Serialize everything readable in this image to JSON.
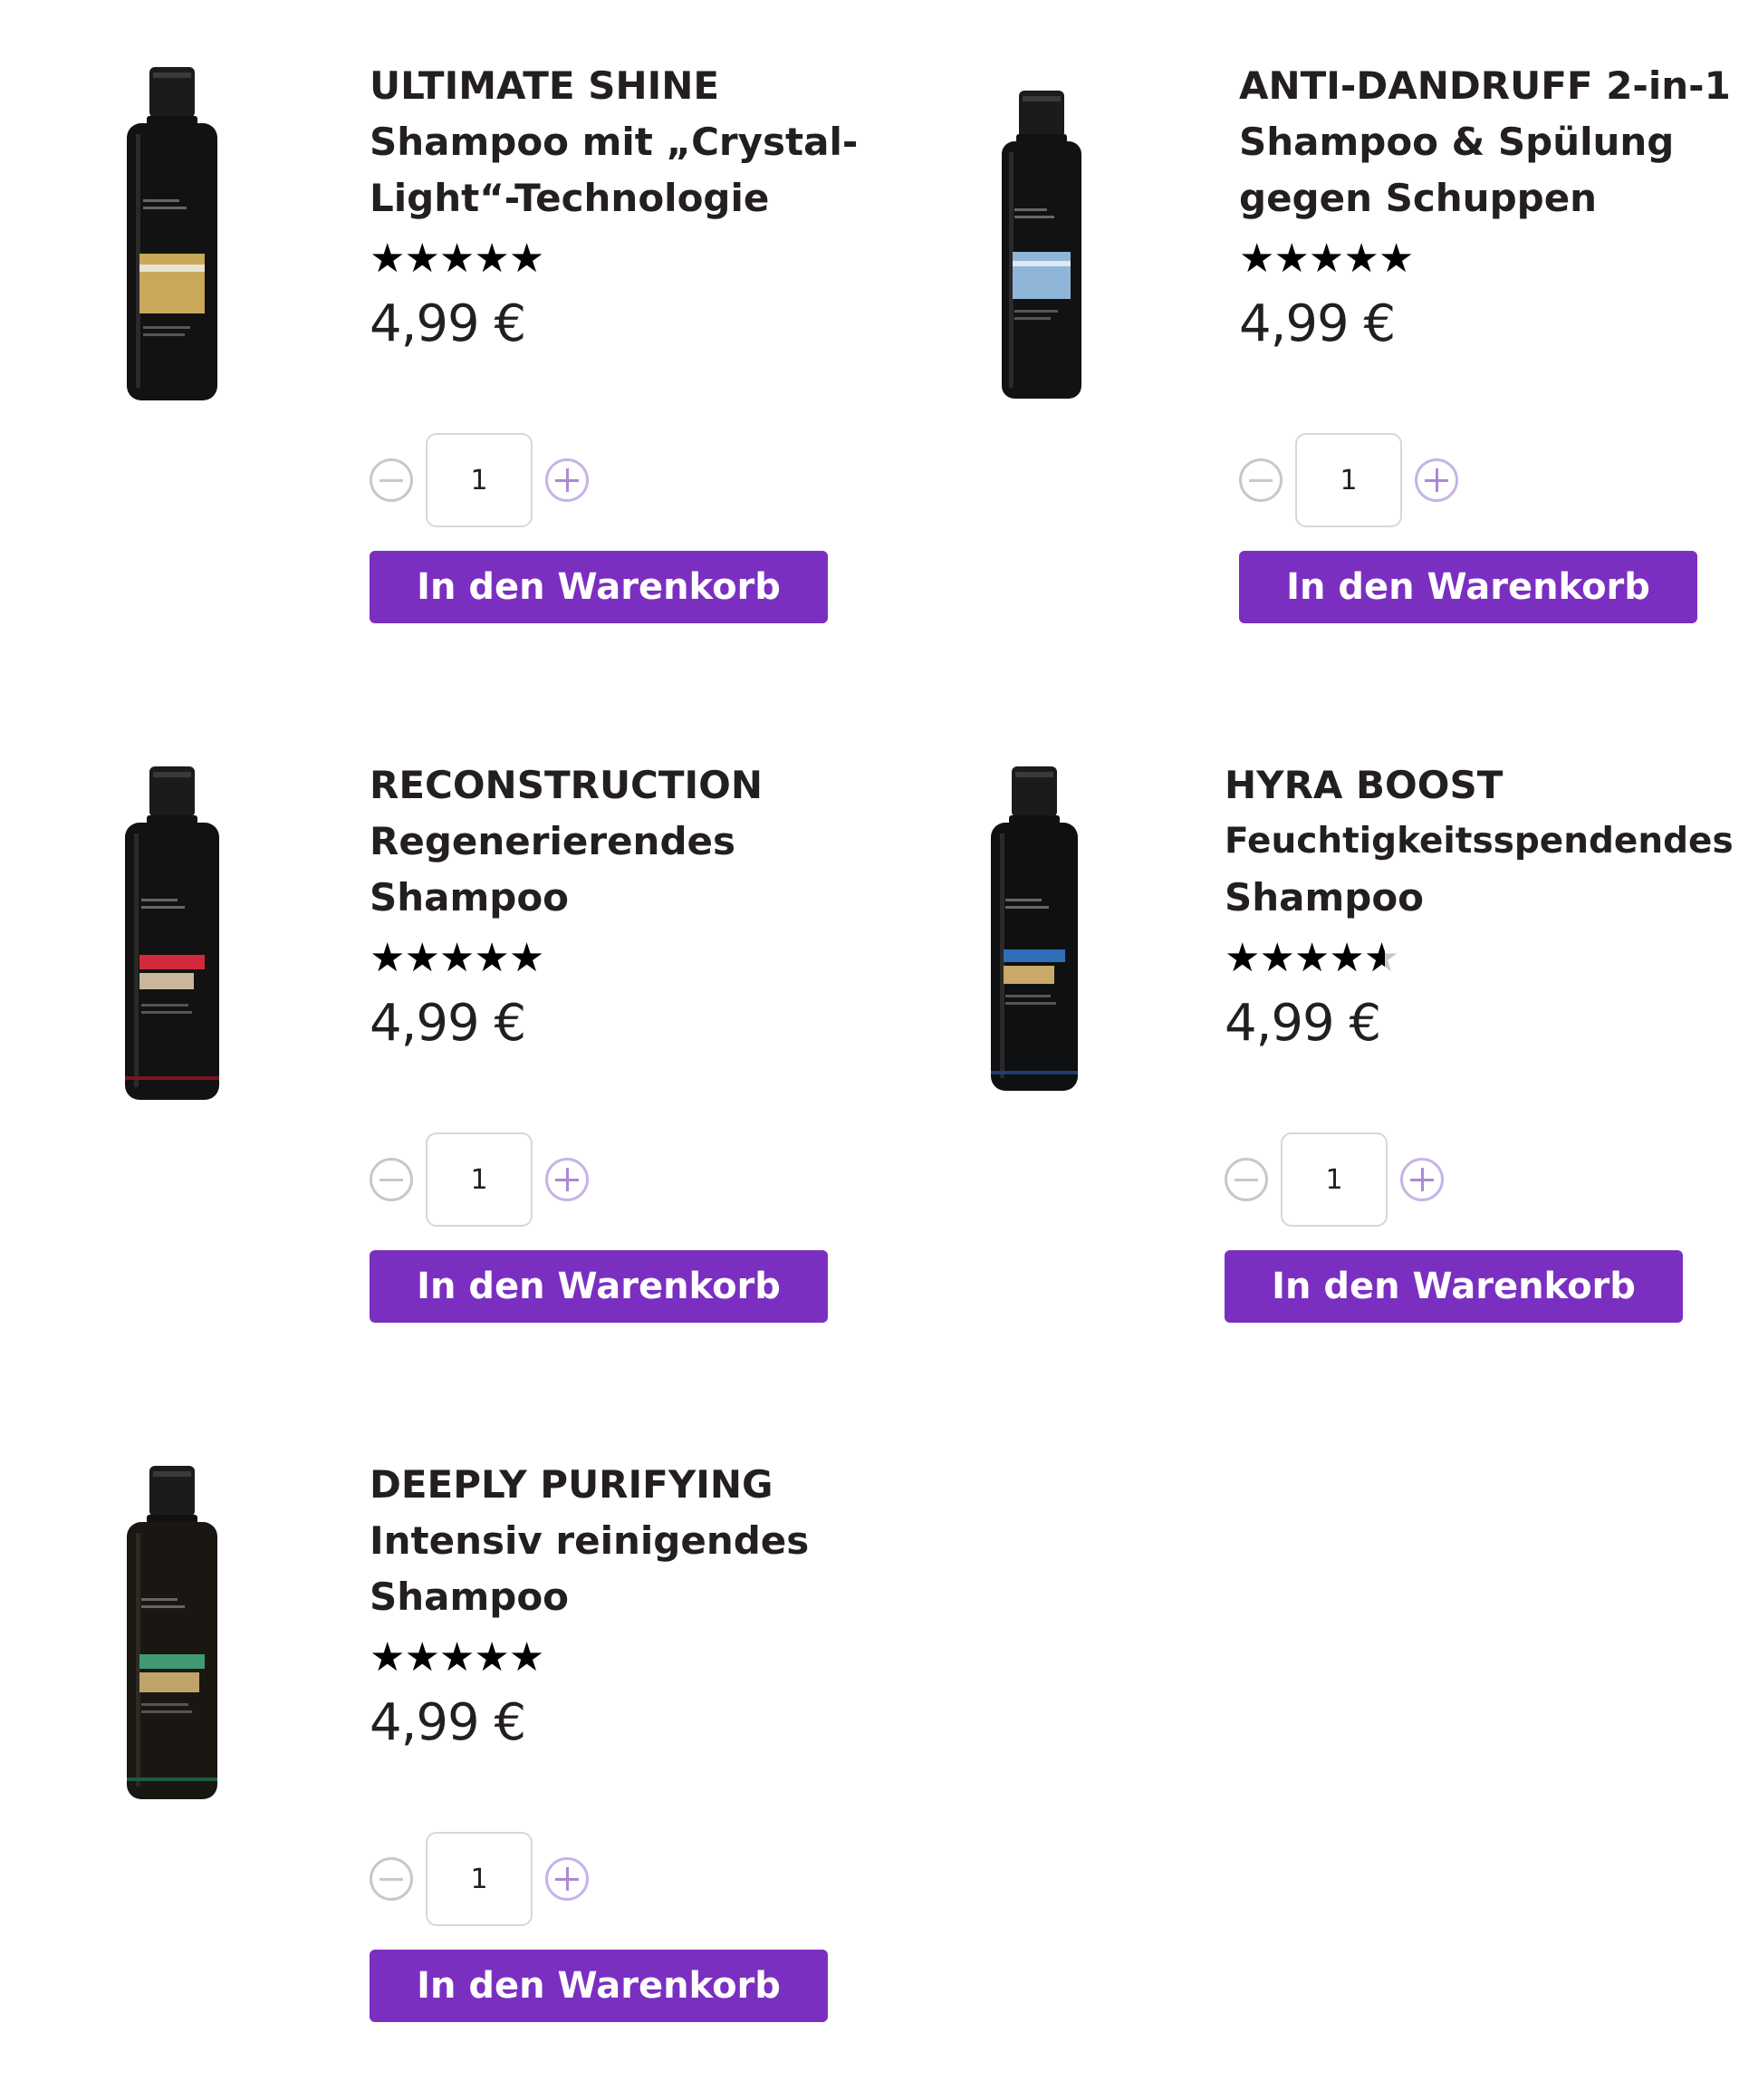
{
  "colors": {
    "accent": "#7b2fc0",
    "text": "#231f20",
    "stepper_minus": "#c9c6cd",
    "stepper_plus": "#a98ad6"
  },
  "products": [
    {
      "title_lines": [
        "ULTIMATE SHINE",
        "Shampoo mit „Crystal-",
        "Light“-Technologie"
      ],
      "rating": 5,
      "price": "4,99 €",
      "quantity": "1",
      "cart_label": "In den Warenkorb",
      "label_color": "#c9a85a"
    },
    {
      "title_lines": [
        "ANTI-DANDRUFF 2-in-1",
        "Shampoo & Spülung",
        "gegen Schuppen"
      ],
      "rating": 5,
      "price": "4,99 €",
      "quantity": "1",
      "cart_label": "In den Warenkorb",
      "label_color": "#8fb6d8"
    },
    {
      "title_lines": [
        "RECONSTRUCTION",
        "Regenerierendes",
        "Shampoo"
      ],
      "rating": 5,
      "price": "4,99 €",
      "quantity": "1",
      "cart_label": "In den Warenkorb",
      "label_color": "#d22a3a"
    },
    {
      "title_lines": [
        "HYRA BOOST",
        "Feuchtigkeitsspendendes",
        "Shampoo"
      ],
      "rating": 4.6,
      "price": "4,99 €",
      "quantity": "1",
      "cart_label": "In den Warenkorb",
      "label_color": "#2f6fb8"
    },
    {
      "title_lines": [
        "DEEPLY PURIFYING",
        "Intensiv reinigendes",
        "Shampoo"
      ],
      "rating": 5,
      "price": "4,99 €",
      "quantity": "1",
      "cart_label": "In den Warenkorb",
      "label_color": "#3f9a72"
    }
  ]
}
